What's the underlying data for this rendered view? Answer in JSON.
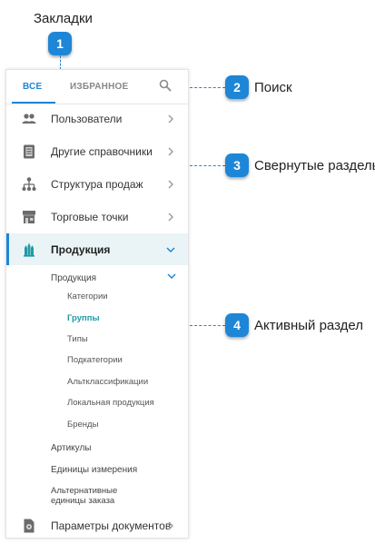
{
  "callouts": [
    {
      "num": "1",
      "label": "Закладки"
    },
    {
      "num": "2",
      "label": "Поиск"
    },
    {
      "num": "3",
      "label": "Свернутые разделы"
    },
    {
      "num": "4",
      "label": "Активный раздел"
    }
  ],
  "tabs": {
    "all": "ВСЕ",
    "favorites": "ИЗБРАННОЕ",
    "search_icon": "search-icon"
  },
  "nav": [
    {
      "label": "Пользователи",
      "icon": "users-icon"
    },
    {
      "label": "Другие справочники",
      "icon": "book-icon"
    },
    {
      "label": "Структура продаж",
      "icon": "hierarchy-icon"
    },
    {
      "label": "Торговые точки",
      "icon": "store-icon"
    },
    {
      "label": "Продукция",
      "icon": "products-icon"
    }
  ],
  "submenu": {
    "group_label": "Продукция",
    "items": [
      "Категории",
      "Группы",
      "Типы",
      "Подкатегории",
      "Альтклассификации",
      "Локальная продукция",
      "Бренды"
    ],
    "active_item": "Группы",
    "others": [
      "Артикулы",
      "Единицы измерения"
    ],
    "alt_units_line1": "Альтернативные",
    "alt_units_line2": "единицы заказа"
  },
  "footer_item": {
    "label": "Параметры документов",
    "icon": "document-settings-icon"
  },
  "colors": {
    "accent": "#1e86d6",
    "active_text": "#1e9aa6",
    "active_bg": "#eaf4f6"
  }
}
